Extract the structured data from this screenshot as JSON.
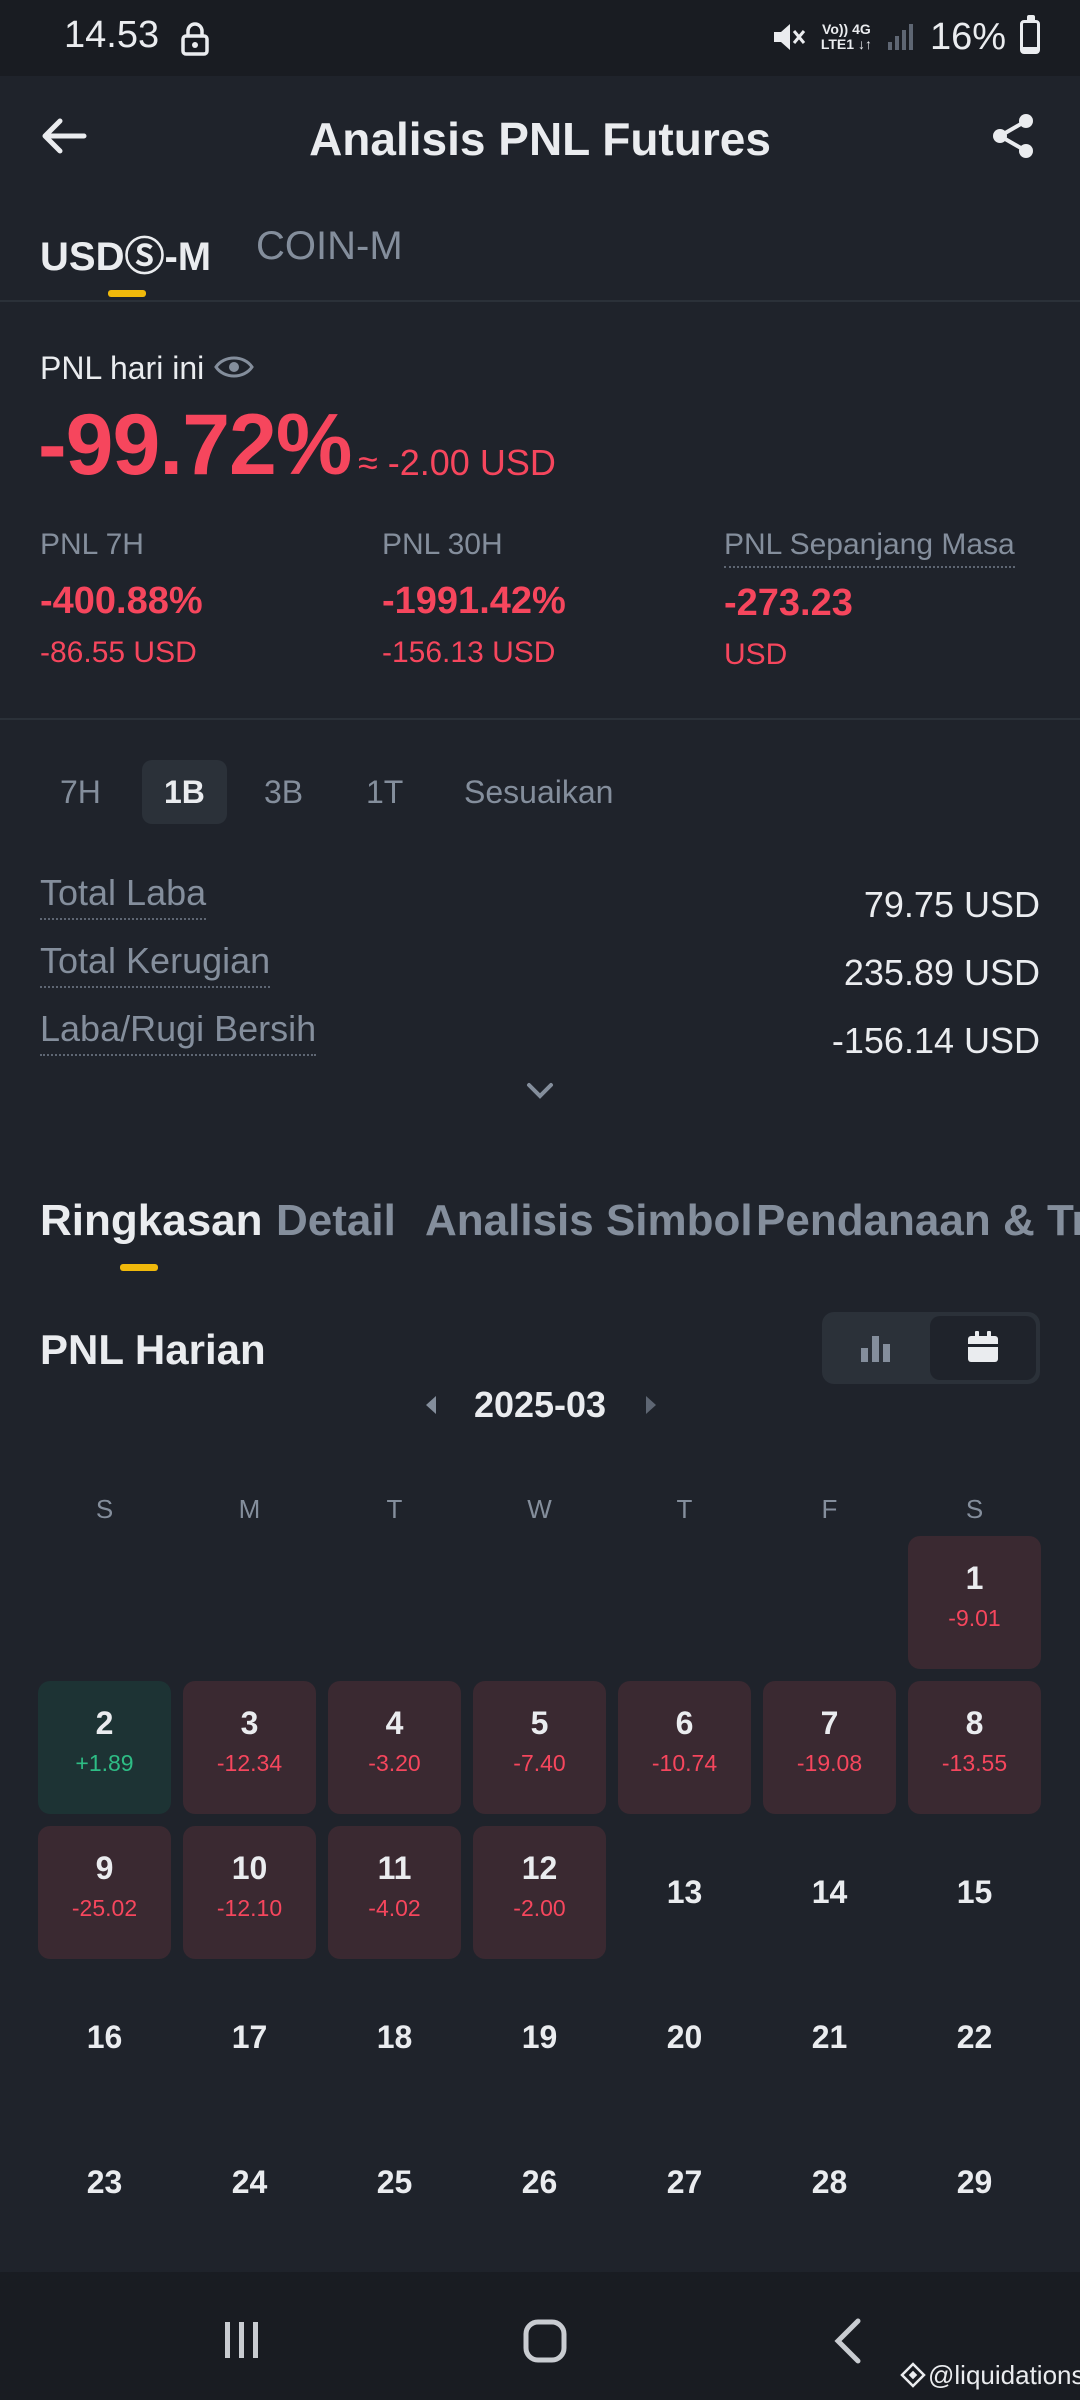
{
  "status_bar": {
    "time": "14.53",
    "net_top": "Vo)) 4G",
    "net_bottom": "LTE1 ↓↑",
    "battery": "16%",
    "battery_level": 0.16
  },
  "header": {
    "title": "Analisis PNL Futures"
  },
  "margin_tabs": [
    {
      "label": "USDⓈ-M",
      "active": true
    },
    {
      "label": "COIN-M",
      "active": false
    }
  ],
  "today": {
    "label": "PNL hari ini",
    "percent": "-99.72%",
    "approx": "≈ -2.00 USD"
  },
  "pnl_cards": [
    {
      "label": "PNL 7H",
      "value": "-400.88%",
      "sub": "-86.55 USD"
    },
    {
      "label": "PNL 30H",
      "value": "-1991.42%",
      "sub": "-156.13 USD"
    },
    {
      "label": "PNL Sepanjang Masa",
      "value": "-273.23",
      "sub": "USD"
    }
  ],
  "range_tabs": [
    {
      "label": "7H",
      "active": false
    },
    {
      "label": "1B",
      "active": true
    },
    {
      "label": "3B",
      "active": false
    },
    {
      "label": "1T",
      "active": false
    },
    {
      "label": "Sesuaikan",
      "active": false
    }
  ],
  "summary": [
    {
      "label": "Total Laba",
      "value": "79.75 USD"
    },
    {
      "label": "Total Kerugian",
      "value": "235.89 USD"
    },
    {
      "label": "Laba/Rugi Bersih",
      "value": "-156.14 USD"
    }
  ],
  "section_tabs": [
    {
      "label": "Ringkasan",
      "active": true
    },
    {
      "label": "Detail",
      "active": false
    },
    {
      "label": "Analisis Simbol",
      "active": false
    },
    {
      "label": "Pendanaan & Tra",
      "active": false
    }
  ],
  "daily": {
    "title": "PNL Harian",
    "month": "2025-03"
  },
  "weekdays": [
    "S",
    "M",
    "T",
    "W",
    "T",
    "F",
    "S"
  ],
  "calendar_rows": [
    [
      null,
      null,
      null,
      null,
      null,
      null,
      {
        "day": "1",
        "pnl": "-9.01",
        "status": "loss"
      }
    ],
    [
      {
        "day": "2",
        "pnl": "+1.89",
        "status": "gain"
      },
      {
        "day": "3",
        "pnl": "-12.34",
        "status": "loss"
      },
      {
        "day": "4",
        "pnl": "-3.20",
        "status": "loss"
      },
      {
        "day": "5",
        "pnl": "-7.40",
        "status": "loss"
      },
      {
        "day": "6",
        "pnl": "-10.74",
        "status": "loss"
      },
      {
        "day": "7",
        "pnl": "-19.08",
        "status": "loss"
      },
      {
        "day": "8",
        "pnl": "-13.55",
        "status": "loss"
      }
    ],
    [
      {
        "day": "9",
        "pnl": "-25.02",
        "status": "loss"
      },
      {
        "day": "10",
        "pnl": "-12.10",
        "status": "loss"
      },
      {
        "day": "11",
        "pnl": "-4.02",
        "status": "loss"
      },
      {
        "day": "12",
        "pnl": "-2.00",
        "status": "loss"
      },
      {
        "day": "13",
        "status": "none"
      },
      {
        "day": "14",
        "status": "none"
      },
      {
        "day": "15",
        "status": "none"
      }
    ],
    [
      {
        "day": "16",
        "status": "none"
      },
      {
        "day": "17",
        "status": "none"
      },
      {
        "day": "18",
        "status": "none"
      },
      {
        "day": "19",
        "status": "none"
      },
      {
        "day": "20",
        "status": "none"
      },
      {
        "day": "21",
        "status": "none"
      },
      {
        "day": "22",
        "status": "none"
      }
    ],
    [
      {
        "day": "23",
        "status": "none"
      },
      {
        "day": "24",
        "status": "none"
      },
      {
        "day": "25",
        "status": "none"
      },
      {
        "day": "26",
        "status": "none"
      },
      {
        "day": "27",
        "status": "none"
      },
      {
        "day": "28",
        "status": "none"
      },
      {
        "day": "29",
        "status": "none"
      }
    ]
  ],
  "watermark": "@liquidations",
  "colors": {
    "background": "#1f232b",
    "accent": "#f0b90b",
    "loss": "#f6465d",
    "gain": "#2ebd85",
    "muted": "#848e9c"
  },
  "icons": {
    "back": "arrow-left-icon",
    "share": "share-icon",
    "eye": "eye-icon",
    "expand": "chevron-down-icon",
    "bar_view": "bar-chart-icon",
    "calendar_view": "calendar-icon",
    "prev_month": "caret-left-icon",
    "next_month": "caret-right-icon",
    "nav_recents": "recents-icon",
    "nav_home": "home-icon",
    "nav_back": "back-icon"
  }
}
